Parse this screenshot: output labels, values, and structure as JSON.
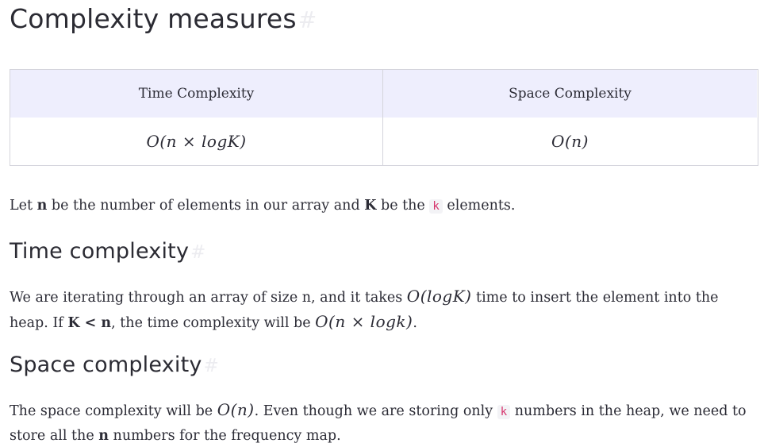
{
  "heading_main": "Complexity measures",
  "heading_anchor": "#",
  "table": {
    "headers": [
      "Time Complexity",
      "Space Complexity"
    ],
    "values": [
      "O(n × logK)",
      "O(n)"
    ]
  },
  "intro": {
    "t1": "Let ",
    "n": "n",
    "t2": " be the number of elements in our array and ",
    "K": "K",
    "t3": " be the ",
    "code": "k",
    "t4": " elements."
  },
  "time_section": {
    "heading": "Time complexity",
    "t1": "We are iterating through an array of size n, and it takes ",
    "math1": "O(logK)",
    "t2": " time to insert the element into the heap. If ",
    "cond": "K < n",
    "t3": ", the time complexity will be ",
    "math2": "O(n × logk)",
    "t4": "."
  },
  "space_section": {
    "heading": "Space complexity",
    "t1": "The space complexity will be ",
    "math1": "O(n)",
    "t2": ". Even though we are storing only ",
    "code": "k",
    "t3": " numbers in the heap, we need to store all the ",
    "n": "n",
    "t4": " numbers for the frequency map."
  }
}
